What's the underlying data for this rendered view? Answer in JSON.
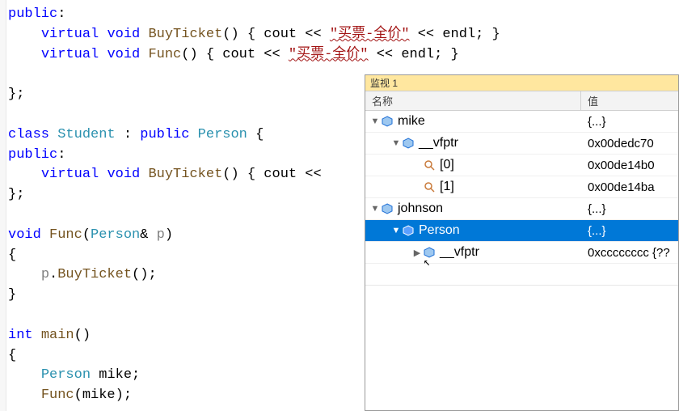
{
  "code": {
    "l1_public": "public",
    "l2_virtual": "virtual",
    "l2_void": "void",
    "l2_func": "BuyTicket",
    "l2_paren": "() { ",
    "l2_cout": "cout",
    "l2_op1": " << ",
    "l2_str": "\"买票-全价\"",
    "l2_op2": " << ",
    "l2_endl": "endl",
    "l2_end": "; }",
    "l3_func": "Func",
    "l3_str": "\"买票-全价\"",
    "l5_close": "};",
    "l7_class": "class",
    "l7_student": "Student",
    "l7_colon": " : ",
    "l7_public": "public",
    "l7_person": "Person",
    "l7_brace": " {",
    "l9_func": "BuyTicket",
    "l9_rest": "() { ",
    "l9_cout": "cout",
    "l9_op": " <<",
    "l12_void": "void",
    "l12_func": "Func",
    "l12_person": "Person",
    "l12_amp": "& ",
    "l12_p": "p",
    "l12_paren2": ")",
    "l14_p": "p",
    "l14_dot": ".",
    "l14_call": "BuyTicket",
    "l14_end": "();",
    "l17_int": "int",
    "l17_main": "main",
    "l17_paren": "()",
    "l19_person": "Person",
    "l19_mike": "mike",
    "l20_func": "Func",
    "l20_mike": "mike",
    "l20_end": ");"
  },
  "watch": {
    "title": "监视 1",
    "col_name": "名称",
    "col_value": "值",
    "rows": [
      {
        "indent": 0,
        "twisty": "open",
        "icon": "blue",
        "name": "mike",
        "value": "{...}",
        "sel": false
      },
      {
        "indent": 1,
        "twisty": "open",
        "icon": "blue",
        "name": "__vfptr",
        "value": "0x00dedc70 ",
        "sel": false
      },
      {
        "indent": 2,
        "twisty": "none",
        "icon": "mag",
        "name": "[0]",
        "value": "0x00de14b0",
        "sel": false
      },
      {
        "indent": 2,
        "twisty": "none",
        "icon": "mag",
        "name": "[1]",
        "value": "0x00de14ba",
        "sel": false
      },
      {
        "indent": 0,
        "twisty": "open",
        "icon": "blue",
        "name": "johnson",
        "value": "{...}",
        "sel": false
      },
      {
        "indent": 1,
        "twisty": "open",
        "icon": "blue",
        "name": "Person",
        "value": "{...}",
        "sel": true
      },
      {
        "indent": 2,
        "twisty": "closed",
        "icon": "blue",
        "name": "__vfptr",
        "value": "0xcccccccc {??",
        "sel": false
      }
    ]
  }
}
